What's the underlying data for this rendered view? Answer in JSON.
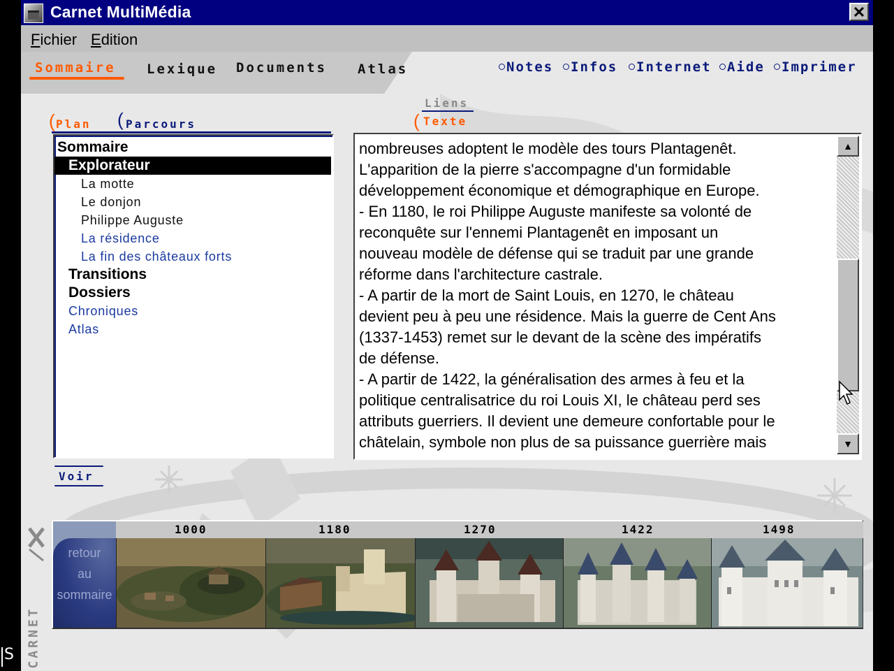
{
  "window": {
    "title": "Carnet MultiMédia",
    "close_glyph": "✕"
  },
  "menubar": {
    "items": [
      {
        "label_u": "F",
        "label_rest": "ichier"
      },
      {
        "label_u": "E",
        "label_rest": "dition"
      }
    ]
  },
  "main_nav": {
    "items": [
      "Sommaire",
      "Lexique",
      "Documents",
      "Atlas"
    ],
    "active": "Sommaire"
  },
  "right_nav": {
    "items": [
      "Notes",
      "Infos",
      "Internet",
      "Aide",
      "Imprimer"
    ]
  },
  "left_tabs": {
    "items": [
      "Plan",
      "Parcours"
    ],
    "active": "Plan"
  },
  "text_tabs": {
    "items": [
      "Liens",
      "Texte"
    ],
    "active": "Texte"
  },
  "tree": {
    "items": [
      {
        "label": "Sommaire",
        "level": 0,
        "style": "bold"
      },
      {
        "label": "Explorateur",
        "level": 1,
        "style": "selected"
      },
      {
        "label": "La motte",
        "level": 2,
        "style": "dark"
      },
      {
        "label": "Le donjon",
        "level": 2,
        "style": "dark"
      },
      {
        "label": "Philippe Auguste",
        "level": 2,
        "style": "dark"
      },
      {
        "label": "La résidence",
        "level": 2,
        "style": "link"
      },
      {
        "label": "La fin des châteaux forts",
        "level": 2,
        "style": "link"
      },
      {
        "label": "Transitions",
        "level": 1,
        "style": "bold"
      },
      {
        "label": "Dossiers",
        "level": 1,
        "style": "bold"
      },
      {
        "label": "Chroniques",
        "level": 1,
        "style": "link"
      },
      {
        "label": "Atlas",
        "level": 1,
        "style": "link"
      }
    ]
  },
  "text_panel": {
    "body": "nombreuses adoptent le modèle des tours Plantagenêt.\nL'apparition de la pierre s'accompagne d'un formidable\ndéveloppement économique et démographique en Europe.\n- En 1180, le roi Philippe Auguste manifeste sa volonté de\nreconquête sur l'ennemi Plantagenêt en imposant un\nnouveau modèle de défense qui se traduit par une grande\nréforme dans l'architecture castrale.\n- A partir de la mort de Saint Louis, en 1270, le château\ndevient peu à peu une résidence. Mais la guerre de Cent Ans\n(1337-1453) remet sur le devant de la scène des impératifs\nde défense.\n- A partir de 1422, la généralisation des armes à feu et la\npolitique centralisatrice du roi Louis XI, le château perd ses\nattributs guerriers. Il devient une demeure confortable pour le\nchâtelain, symbole non plus de sa puissance guerrière mais",
    "scroll_up": "▲",
    "scroll_down": "▼"
  },
  "voir_label": "Voir",
  "logo_text": "CARNET",
  "timeline": {
    "retour": [
      "retour",
      "au",
      "sommaire"
    ],
    "years": [
      "1000",
      "1180",
      "1270",
      "1422",
      "1498"
    ]
  },
  "status_fragment": "S",
  "colors": {
    "titlebar": "#000080",
    "accent_orange": "#ff5a00",
    "nav_blue": "#0a1a7a",
    "link_blue": "#1a3aa0"
  }
}
